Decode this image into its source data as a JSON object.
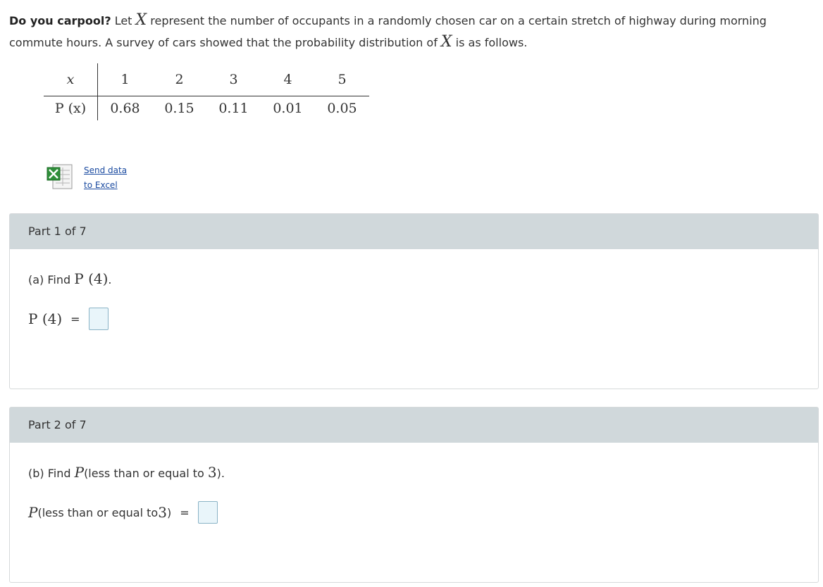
{
  "intro": {
    "lead": "Do you carpool?",
    "t1": " Let ",
    "var1": "X",
    "t2": " represent the number of occupants in a randomly chosen car on a certain stretch of highway during morning commute hours. A survey of cars showed that the probability distribution of ",
    "var2": "X",
    "t3": " is as follows."
  },
  "table": {
    "x_header": "x",
    "p_header": "P (x)",
    "x_values": [
      "1",
      "2",
      "3",
      "4",
      "5"
    ],
    "p_values": [
      "0.68",
      "0.15",
      "0.11",
      "0.01",
      "0.05"
    ]
  },
  "excel": {
    "icon": "excel-spreadsheet-icon",
    "line1": "Send data",
    "line2": "to Excel"
  },
  "parts": [
    {
      "header": "Part 1 of 7",
      "q_prefix": "(a) Find ",
      "q_math": "P (4)",
      "q_suffix": ".",
      "ans_label": "P (4)",
      "eq": "="
    },
    {
      "header": "Part 2 of 7",
      "q_prefix": "(b) Find ",
      "q_math": "P",
      "q_mid": "(less than or equal to ",
      "q_num": "3",
      "q_suffix": ").",
      "ans_p": "P",
      "ans_mid": "(less than or equal to ",
      "ans_num": "3",
      "ans_close": ")",
      "eq": "="
    }
  ],
  "colors": {
    "part_header_bg": "#d0d8db",
    "answer_box_border": "#8ab3c6",
    "answer_box_bg": "#e9f5fa",
    "link": "#1a4aa0"
  }
}
